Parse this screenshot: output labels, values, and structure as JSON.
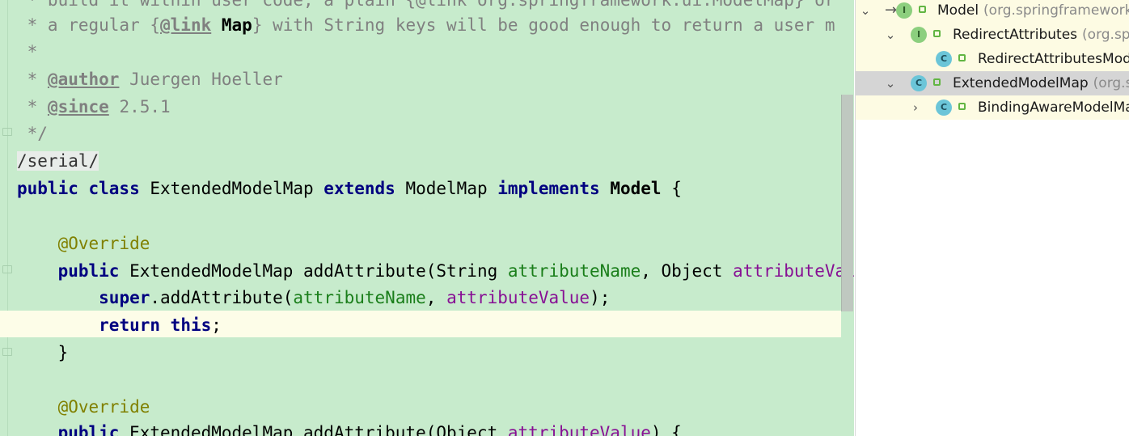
{
  "editor": {
    "lines": {
      "l0": " * build it within user code, a plain {@link org.springframework.ui.ModelMap} or",
      "l1a": " * a regular {",
      "l1tag": "@link",
      "l1b": " ",
      "l1ref": "Map",
      "l1c": "} with String keys will be good enough to return a user m",
      "l2": " *",
      "l3a": " * ",
      "l3tag": "@author",
      "l3b": " Juergen Hoeller",
      "l4a": " * ",
      "l4tag": "@since",
      "l4b": " 2.5.1",
      "l5": " */",
      "l6": "/serial/",
      "l7kw1": "public class",
      "l7a": " ExtendedModelMap ",
      "l7kw2": "extends",
      "l7b": " ModelMap ",
      "l7kw3": "implements",
      "l7c": " ",
      "l7d": "Model",
      "l7e": " {",
      "l9ann": "    @Override",
      "l10indent": "    ",
      "l10kw": "public",
      "l10a": " ExtendedModelMap addAttribute(String ",
      "l10p1": "attributeName",
      "l10b": ", Object ",
      "l10p2": "attributeValue",
      "l11indent": "        ",
      "l11kw": "super",
      "l11a": ".addAttribute(",
      "l11p1": "attributeName",
      "l11b": ", ",
      "l11p2": "attributeValue",
      "l11c": ");",
      "l12indent": "        ",
      "l12kw1": "return",
      "l12a": " ",
      "l12kw2": "this",
      "l12b": ";",
      "l13": "    }",
      "l15ann": "    @Override",
      "l16indent": "    ",
      "l16kw": "public",
      "l16a": " ExtendedModelMap addAttribute(Object ",
      "l16p": "attributeValue",
      "l16b": ") {"
    }
  },
  "hierarchy": {
    "items": [
      {
        "name": "Model",
        "pkg": "(org.springframework.ui)",
        "badge": "I"
      },
      {
        "name": "RedirectAttributes",
        "pkg": "(org.springframework.web.servlet.mvc.support)",
        "badge": "I"
      },
      {
        "name": "RedirectAttributesModelMap",
        "pkg": "",
        "badge": "C"
      },
      {
        "name": "ExtendedModelMap",
        "pkg": "(org.springframework.ui)",
        "badge": "C"
      },
      {
        "name": "BindingAwareModelMap",
        "pkg": "",
        "badge": "C"
      }
    ]
  },
  "colors": {
    "editor_bg": "#c7ebcc",
    "keyword": "#000080",
    "annotation": "#808000",
    "parameter": "#1a7e1a",
    "field": "#871094"
  },
  "icons": [
    "fold-marker-icon",
    "chevron-down-icon",
    "chevron-right-icon",
    "interface-icon",
    "class-icon",
    "lock-icon",
    "go-to-icon"
  ]
}
